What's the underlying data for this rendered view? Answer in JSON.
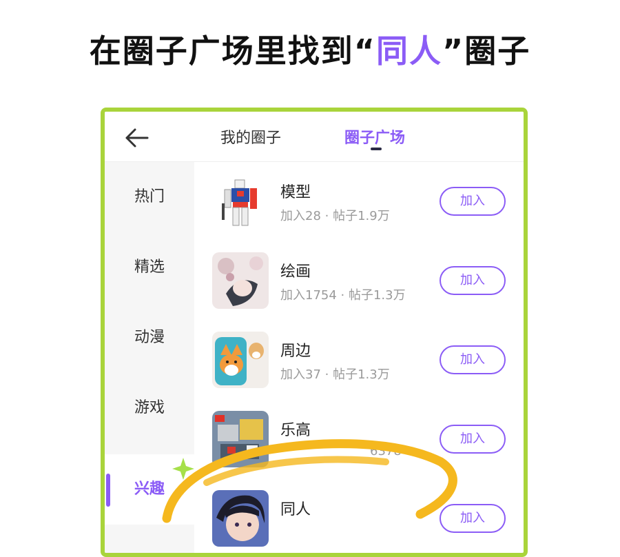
{
  "headline": {
    "part1": "在圈子广场里找到",
    "open_quote": "“",
    "highlight": "同人",
    "close_quote": "”",
    "part2": "圈子"
  },
  "topbar": {
    "tabs": [
      {
        "label": "我的圈子",
        "active": false
      },
      {
        "label": "圈子广场",
        "active": true
      }
    ]
  },
  "sidebar": {
    "items": [
      {
        "label": "热门",
        "active": false
      },
      {
        "label": "精选",
        "active": false
      },
      {
        "label": "动漫",
        "active": false
      },
      {
        "label": "游戏",
        "active": false
      },
      {
        "label": "兴趣",
        "active": true
      }
    ]
  },
  "circles": [
    {
      "title": "模型",
      "stats": "加入28 · 帖子1.9万",
      "join_label": "加入",
      "thumb": "gundam-image"
    },
    {
      "title": "绘画",
      "stats": "加入1754 · 帖子1.3万",
      "join_label": "加入",
      "thumb": "anime-drawing-image"
    },
    {
      "title": "周边",
      "stats": "加入37 · 帖子1.3万",
      "join_label": "加入",
      "thumb": "corgi-merch-image"
    },
    {
      "title": "乐高",
      "stats": "6378",
      "join_label": "加入",
      "thumb": "lego-box-image"
    },
    {
      "title": "同人",
      "stats": "",
      "join_label": "加入",
      "thumb": "anime-character-image"
    }
  ],
  "colors": {
    "accent": "#8b5cf6",
    "frame": "#a9d43b",
    "highlight_stroke": "#f5b81e"
  }
}
